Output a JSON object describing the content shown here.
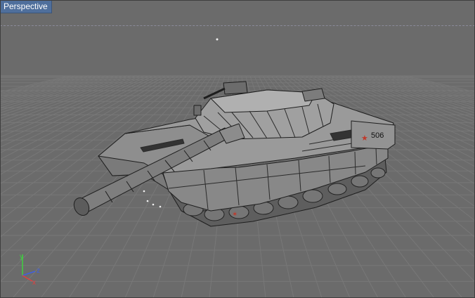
{
  "viewport": {
    "label": "Perspective",
    "background_color": "#6b6b6b",
    "grid_color": "#787878",
    "label_bg_color": "#4f6f9c"
  },
  "model": {
    "name": "tank-wireframe",
    "hull_number": "506",
    "wire_color": "#1e1e1e",
    "fill_color": "#8a8a8a",
    "star_color": "#c0392b"
  },
  "axis_gizmo": {
    "x_label": "x",
    "y_label": "y",
    "z_label": "z",
    "x_color": "#e04040",
    "y_color": "#40d040",
    "z_color": "#4060e0"
  }
}
